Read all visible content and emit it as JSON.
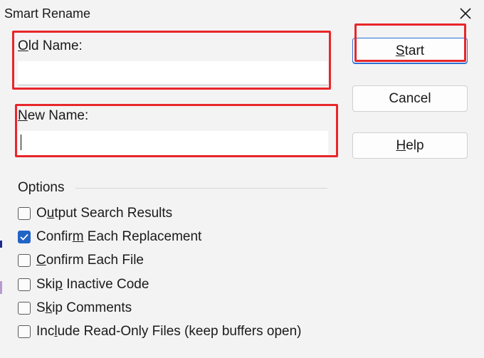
{
  "window": {
    "title": "Smart Rename",
    "close_glyph": "✕"
  },
  "fields": {
    "old_name": {
      "label_first": "O",
      "label_rest": "ld Name:",
      "value": ""
    },
    "new_name": {
      "label_first": "N",
      "label_rest": "ew Name:",
      "value": ""
    }
  },
  "buttons": {
    "start": {
      "pre": "",
      "accel": "S",
      "post": "tart"
    },
    "cancel": {
      "label": "Cancel"
    },
    "help": {
      "pre": "",
      "accel": "H",
      "post": "elp"
    }
  },
  "options": {
    "group_label": "Options",
    "items": [
      {
        "pre": "O",
        "accel": "u",
        "post": "tput Search Results",
        "checked": false
      },
      {
        "pre": "Confir",
        "accel": "m",
        "post": " Each Replacement",
        "checked": true
      },
      {
        "pre": "",
        "accel": "C",
        "post": "onfirm Each File",
        "checked": false
      },
      {
        "pre": "Ski",
        "accel": "p",
        "post": " Inactive Code",
        "checked": false
      },
      {
        "pre": "S",
        "accel": "k",
        "post": "ip Comments",
        "checked": false
      },
      {
        "pre": "Inc",
        "accel": "l",
        "post": "ude Read-Only Files (keep buffers open)",
        "checked": false
      }
    ]
  },
  "colors": {
    "highlight": "#e8262a",
    "accent": "#2164c6"
  }
}
